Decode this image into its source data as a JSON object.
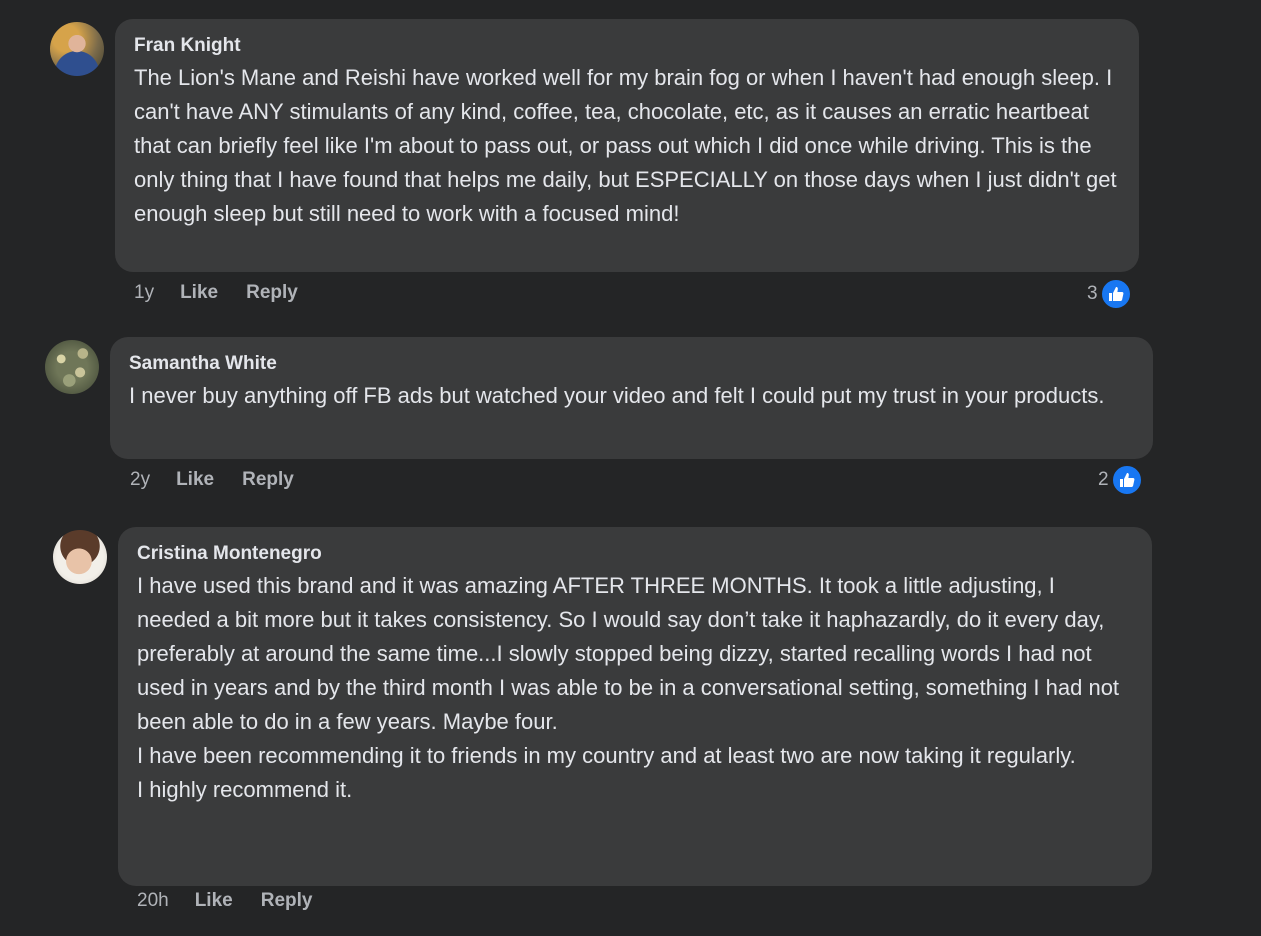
{
  "comments": [
    {
      "author": "Fran Knight",
      "text": "The Lion's Mane and Reishi have worked well for my brain fog or when I haven't had enough sleep. I can't have ANY stimulants of any kind, coffee, tea, chocolate, etc, as it causes an erratic heartbeat that can briefly feel like I'm about to pass out, or pass out which I did once while driving. This is the only thing that I have found that helps me daily, but ESPECIALLY on those days when I just didn't get enough sleep but still need to work with a focused mind!",
      "time": "1y",
      "like_label": "Like",
      "reply_label": "Reply",
      "reaction_count": "3",
      "reaction_icon": "thumbs-up-icon"
    },
    {
      "author": "Samantha White",
      "text": "I never buy anything off FB ads but watched your video and felt I could put my trust in your products.",
      "time": "2y",
      "like_label": "Like",
      "reply_label": "Reply",
      "reaction_count": "2",
      "reaction_icon": "thumbs-up-icon"
    },
    {
      "author": "Cristina Montenegro",
      "text_lines": [
        "I have used this brand and it was amazing AFTER THREE MONTHS. It took a little adjusting, I needed a bit more but it takes consistency. So I would say don’t take it haphazardly, do it every day, preferably at around the same time...I slowly stopped being dizzy, started recalling words I had not used in years and by the third month I was able to be in a conversational setting, something I had not been able to do in a few years. Maybe four.",
        "I have been recommending it to friends in my country and at least two are now taking it regularly.",
        "I highly recommend it."
      ],
      "time": "20h",
      "like_label": "Like",
      "reply_label": "Reply"
    }
  ],
  "colors": {
    "background": "#242526",
    "bubble": "#3a3b3c",
    "text": "#e4e6eb",
    "secondary_text": "#b0b3b8",
    "like_blue": "#1877f2"
  }
}
